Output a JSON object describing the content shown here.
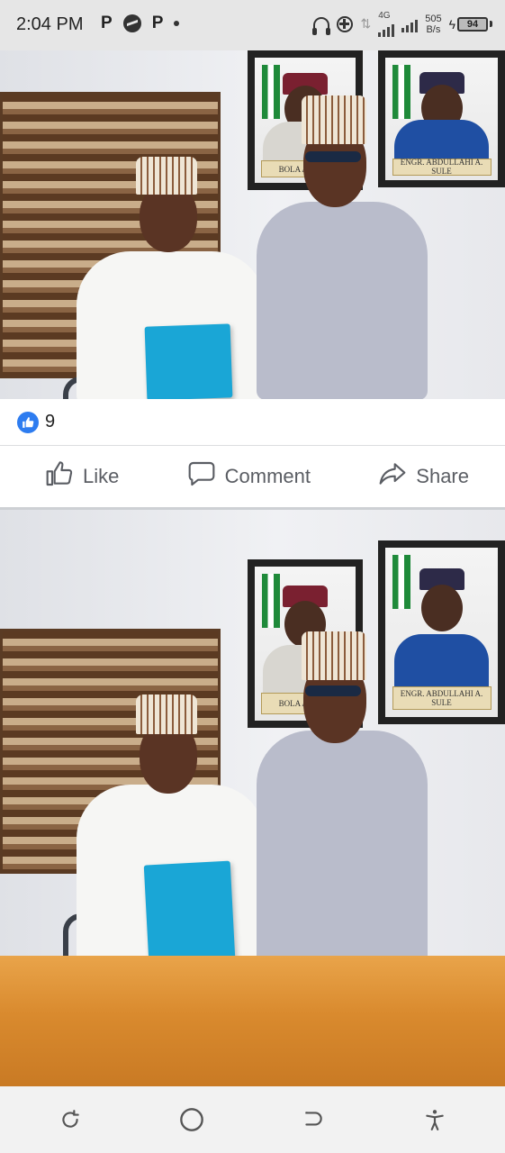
{
  "status_bar": {
    "time": "2:04 PM",
    "left_icons": [
      "p-app-icon",
      "messenger-icon",
      "p-app-icon",
      "dot"
    ],
    "p_glyph": "P",
    "network": "4G",
    "speed_value": "505",
    "speed_unit": "B/s",
    "battery": "94"
  },
  "post": {
    "reaction_count": "9",
    "actions": {
      "like": "Like",
      "comment": "Comment",
      "share": "Share"
    },
    "accent_color": "#2d7cf0"
  },
  "photo_captions": {
    "left_portrait": "BOLA AHMED",
    "right_portrait": "ENGR. ABDULLAHI A. SULE"
  },
  "nav_bar": {
    "icons": [
      "recents-icon",
      "home-icon",
      "back-icon",
      "accessibility-icon"
    ]
  }
}
